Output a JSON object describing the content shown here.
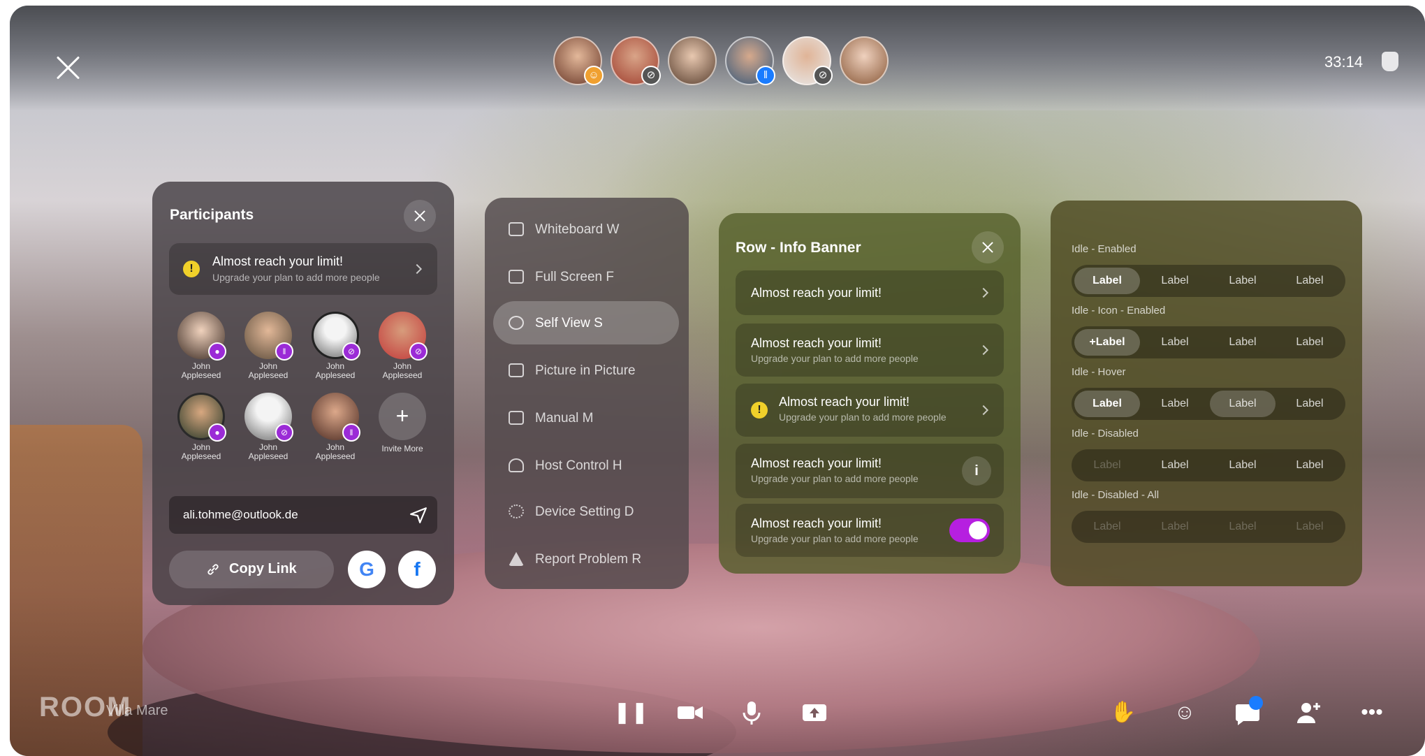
{
  "top_bar": {
    "timer": "33:14",
    "participants_preview": [
      {
        "badge_color": "#f0a030",
        "badge_icon": "emoji-icon"
      },
      {
        "badge_color": "#555555",
        "badge_icon": "mic-muted-icon"
      },
      {
        "badge_color": "",
        "badge_icon": ""
      },
      {
        "badge_color": "#1a7cff",
        "badge_icon": "audio-wave-icon"
      },
      {
        "badge_color": "#555555",
        "badge_icon": "mic-muted-icon"
      },
      {
        "badge_color": "",
        "badge_icon": ""
      }
    ]
  },
  "participants_panel": {
    "title": "Participants",
    "banner": {
      "title": "Almost reach your limit!",
      "subtitle": "Upgrade your plan to add more people"
    },
    "people": [
      {
        "first": "John",
        "last": "Appleseed",
        "status": "mic-icon"
      },
      {
        "first": "John",
        "last": "Appleseed",
        "status": "audio-wave-icon"
      },
      {
        "first": "John",
        "last": "Appleseed",
        "status": "mic-muted-icon"
      },
      {
        "first": "John",
        "last": "Appleseed",
        "status": "mic-muted-icon"
      },
      {
        "first": "John",
        "last": "Appleseed",
        "status": "mic-icon"
      },
      {
        "first": "John",
        "last": "Appleseed",
        "status": "mic-muted-icon"
      },
      {
        "first": "John",
        "last": "Appleseed",
        "status": "audio-wave-icon"
      }
    ],
    "invite_label": "Invite More",
    "email_value": "ali.tohme@outlook.de",
    "copy_link_label": "Copy Link"
  },
  "menu": {
    "items": [
      {
        "label": "Whiteboard W"
      },
      {
        "label": "Full Screen F"
      },
      {
        "label": "Self View S"
      },
      {
        "label": "Picture in Picture"
      },
      {
        "label": "Manual M"
      },
      {
        "label": "Host Control H"
      },
      {
        "label": "Device Setting D"
      },
      {
        "label": "Report Problem R"
      }
    ],
    "active_index": 2
  },
  "info_banner_panel": {
    "title": "Row - Info Banner",
    "rows": [
      {
        "title": "Almost reach your limit!",
        "subtitle": ""
      },
      {
        "title": "Almost reach your limit!",
        "subtitle": "Upgrade your plan to add more people"
      },
      {
        "title": "Almost reach your limit!",
        "subtitle": "Upgrade your plan to add more people"
      },
      {
        "title": "Almost reach your limit!",
        "subtitle": "Upgrade your plan to add more people"
      },
      {
        "title": "Almost reach your limit!",
        "subtitle": "Upgrade your plan to add more people"
      }
    ],
    "toggle_on": true
  },
  "segments_panel": {
    "groups": [
      {
        "label": "Idle - Enabled",
        "options": [
          "Label",
          "Label",
          "Label",
          "Label"
        ]
      },
      {
        "label": "Idle - Icon - Enabled",
        "options": [
          "Label",
          "Label",
          "Label",
          "Label"
        ]
      },
      {
        "label": "Idle - Hover",
        "options": [
          "Label",
          "Label",
          "Label",
          "Label"
        ]
      },
      {
        "label": "Idle - Disabled",
        "options": [
          "Label",
          "Label",
          "Label",
          "Label"
        ]
      },
      {
        "label": "Idle - Disabled - All",
        "options": [
          "Label",
          "Label",
          "Label",
          "Label"
        ]
      }
    ]
  },
  "bottom_bar": {
    "logo": "ROOM",
    "room_name": "Villa Mare"
  },
  "colors": {
    "accent_purple": "#b61fe0",
    "warning": "#f0d02a",
    "notification": "#1a7cff"
  }
}
